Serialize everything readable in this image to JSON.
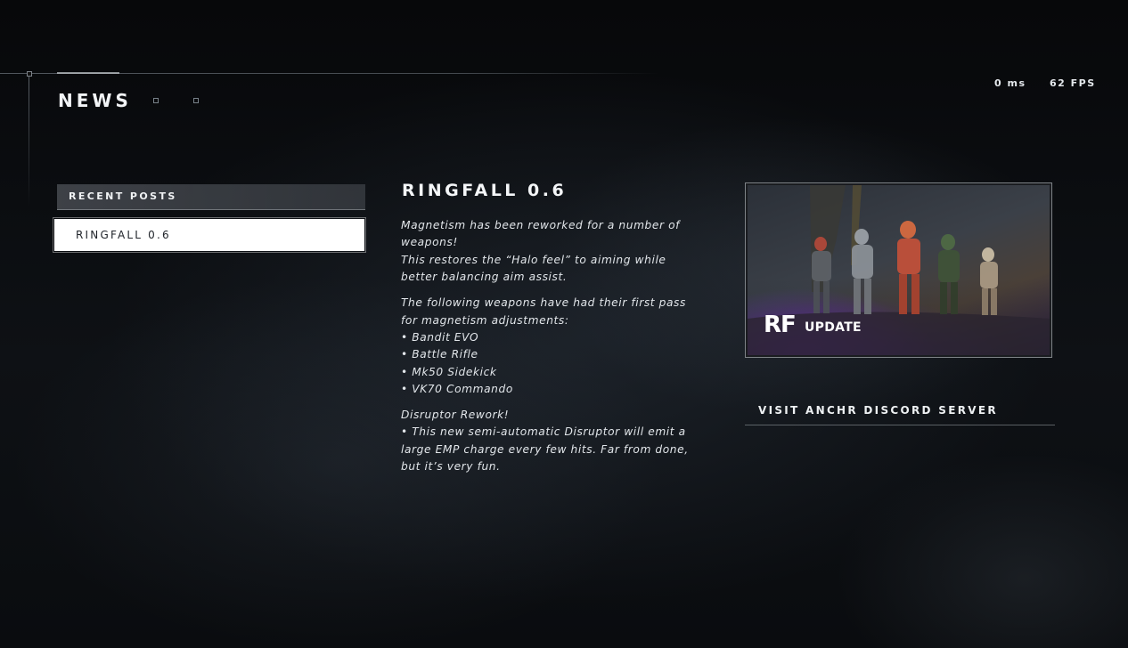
{
  "header": {
    "title": "NEWS",
    "pager_dots": 2
  },
  "perf": {
    "latency": "0 ms",
    "fps": "62 FPS"
  },
  "sidebar": {
    "section_label": "RECENT POSTS",
    "items": [
      {
        "label": "RINGFALL 0.6",
        "selected": true
      }
    ]
  },
  "article": {
    "title": "RINGFALL 0.6",
    "paragraphs": [
      [
        "Magnetism has been reworked for a number of",
        "weapons!",
        "This restores the “Halo feel” to aiming while",
        "better balancing aim assist."
      ],
      [
        "The following weapons have had their first pass",
        "for magnetism adjustments:",
        "• Bandit EVO",
        "• Battle Rifle",
        "• Mk50 Sidekick",
        "• VK70 Commando"
      ],
      [
        "Disruptor Rework!",
        "• This new semi-automatic Disruptor will emit a",
        "large EMP charge every few hits. Far from done,",
        "but it’s very fun."
      ]
    ]
  },
  "promo_image": {
    "badge_logo": "RF",
    "badge_text": "UPDATE",
    "accent_color": "#7b2fe0"
  },
  "discord": {
    "label": "VISIT ANCHR DISCORD SERVER"
  }
}
